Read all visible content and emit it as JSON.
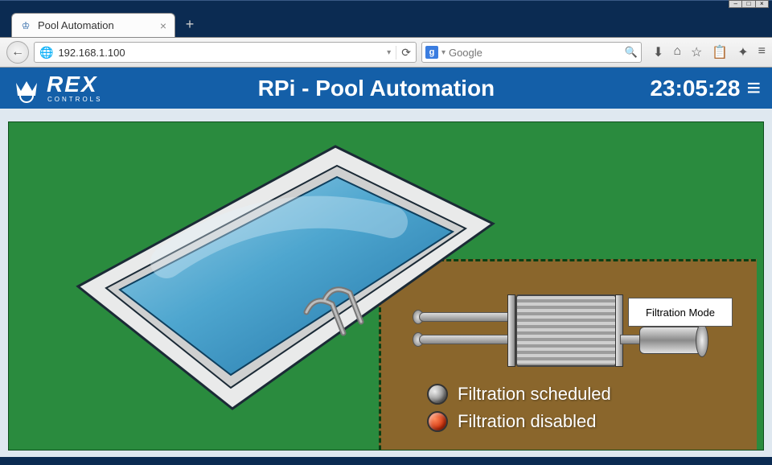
{
  "window": {
    "minimize": "–",
    "maximize": "□",
    "close": "×"
  },
  "browser": {
    "tab_title": "Pool Automation",
    "new_tab": "+",
    "tab_close": "×",
    "url": "192.168.1.100",
    "search_placeholder": "Google",
    "search_provider_initial": "g"
  },
  "app": {
    "logo_main": "REX",
    "logo_sub": "CONTROLS",
    "title": "RPi - Pool Automation",
    "clock": "23:05:28"
  },
  "controls": {
    "mode_button": "Filtration Mode"
  },
  "legend": {
    "scheduled": "Filtration scheduled",
    "disabled": "Filtration disabled"
  },
  "icons": {
    "back": "←",
    "reload": "⟳",
    "dropdown": "▾",
    "search": "🔍",
    "download": "⬇",
    "home": "⌂",
    "star": "☆",
    "clipboard": "📋",
    "puzzle": "✦",
    "menu": "≡",
    "hamburger": "≡",
    "globe": "🌐",
    "crown": "♔"
  }
}
